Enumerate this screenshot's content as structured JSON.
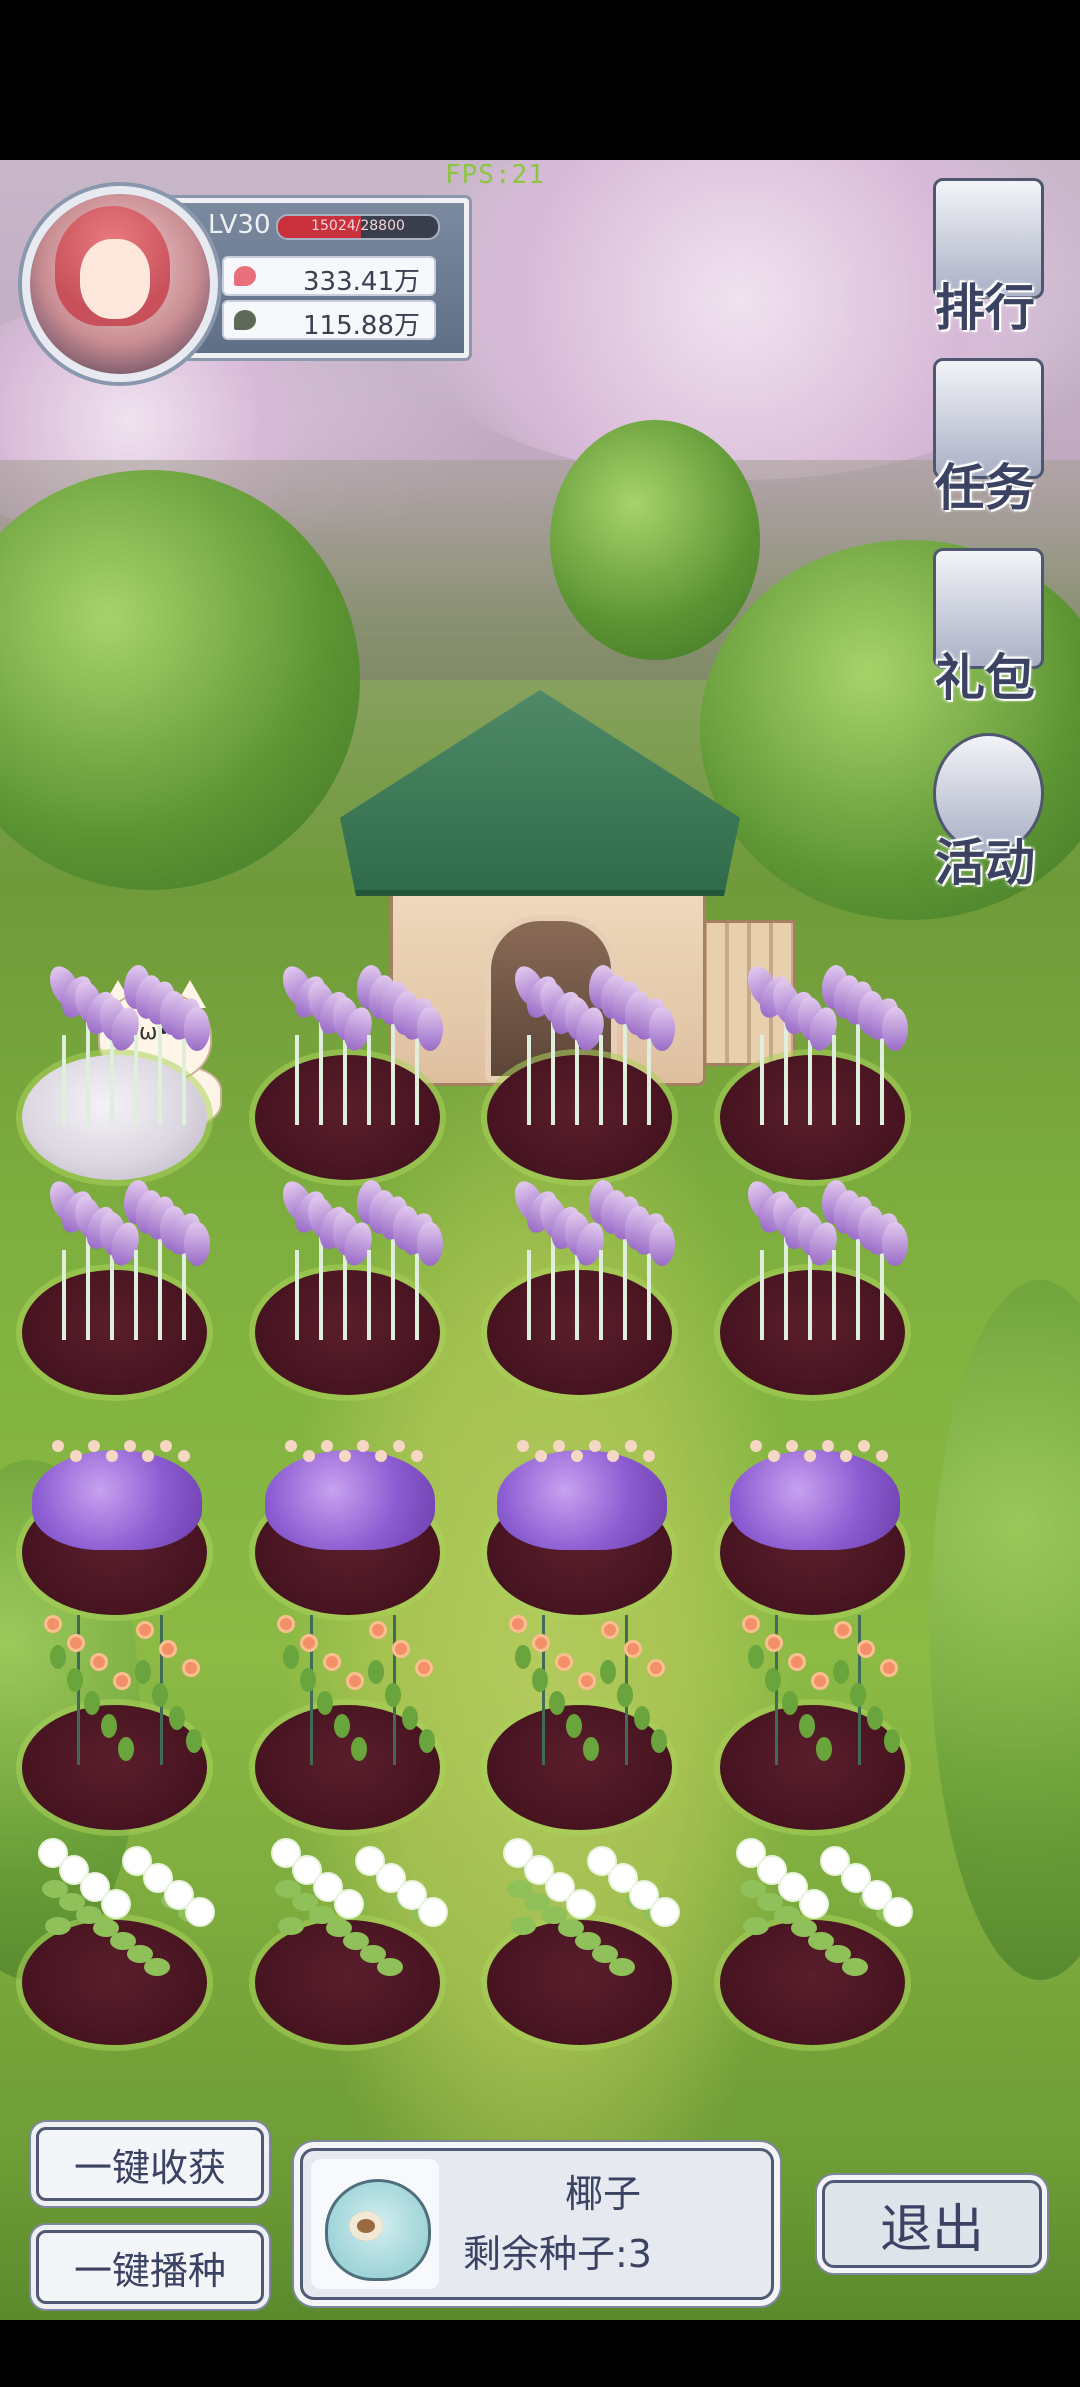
{
  "hud": {
    "fps": "FPS:21",
    "level": "LV30",
    "xp": {
      "current": 15024,
      "max": 28800,
      "text": "15024/28800"
    },
    "currency_1": "333.41万",
    "currency_2": "115.88万"
  },
  "side_menu": [
    {
      "label": "排行",
      "icon": "ranking-icon"
    },
    {
      "label": "任务",
      "icon": "task-scroll-icon"
    },
    {
      "label": "礼包",
      "icon": "gift-box-icon"
    },
    {
      "label": "活动",
      "icon": "event-balloon-icon"
    }
  ],
  "garden": {
    "rows": [
      [
        "iris",
        "iris",
        "iris",
        "iris"
      ],
      [
        "iris",
        "iris",
        "iris",
        "iris"
      ],
      [
        "hydrangea",
        "hydrangea",
        "hydrangea",
        "hydrangea"
      ],
      [
        "rose",
        "rose",
        "rose",
        "rose"
      ],
      [
        "jasmine",
        "jasmine",
        "jasmine",
        "jasmine"
      ]
    ]
  },
  "bottom": {
    "harvest_all": "一键收获",
    "sow_all": "一键播种",
    "seed_name": "椰子",
    "seed_remaining": "剩余种子:3",
    "exit": "退出"
  },
  "colors": {
    "ui_text": "#3b4262",
    "xp_fill": "#c9323c",
    "soil": "#4a1522"
  }
}
